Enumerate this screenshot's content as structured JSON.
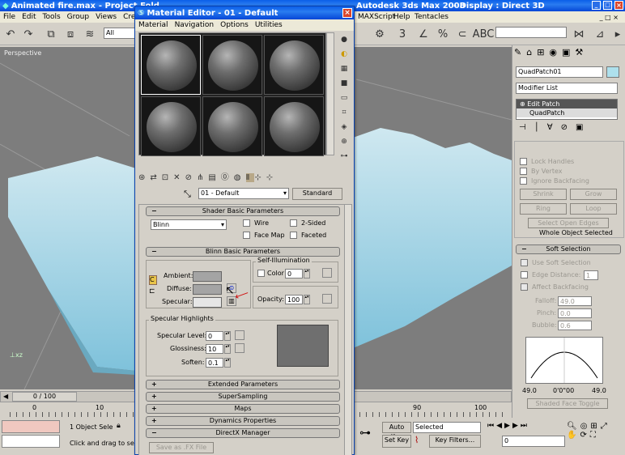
{
  "app": {
    "title": "Animated fire.max",
    "title_mid": "- Project Fold",
    "title_right": "Autodesk 3ds Max 2008",
    "title_display": "- Display : Direct 3D",
    "menus": [
      "File",
      "Edit",
      "Tools",
      "Group",
      "Views",
      "Create"
    ],
    "menus_right": [
      "MAXScript",
      "Help",
      "Tentacles"
    ],
    "selection_filter": "All",
    "viewport_label": "Perspective"
  },
  "material_editor": {
    "title": "Material Editor - 01 - Default",
    "menus": [
      "Material",
      "Navigation",
      "Options",
      "Utilities"
    ],
    "material_name": "01 - Default",
    "material_type": "Standard",
    "shader": {
      "header": "Shader Basic Parameters",
      "shader_type": "Blinn",
      "wire": "Wire",
      "two_sided": "2-Sided",
      "face_map": "Face Map",
      "faceted": "Faceted"
    },
    "blinn": {
      "header": "Blinn Basic Parameters",
      "self_illum": "Self-Illumination",
      "ambient": "Ambient:",
      "diffuse": "Diffuse:",
      "specular": "Specular:",
      "color_label": "Color",
      "color_value": "0",
      "opacity_label": "Opacity:",
      "opacity_value": "100"
    },
    "highlights": {
      "group": "Specular Highlights",
      "level_label": "Specular Level:",
      "level": "0",
      "gloss_label": "Glossiness:",
      "gloss": "10",
      "soften_label": "Soften:",
      "soften": "0.1"
    },
    "rollouts": [
      "Extended Parameters",
      "SuperSampling",
      "Maps",
      "Dynamics Properties",
      "DirectX Manager"
    ],
    "save_fx": "Save as .FX File"
  },
  "command_panel": {
    "object_name": "QuadPatch01",
    "modifier_list": "Modifier List",
    "stack": [
      "Edit Patch",
      "QuadPatch"
    ],
    "lock_handles": "Lock Handles",
    "by_vertex": "By Vertex",
    "ignore_backfacing": "Ignore Backfacing",
    "shrink": "Shrink",
    "grow": "Grow",
    "ring": "Ring",
    "loop": "Loop",
    "select_open_edges": "Select Open Edges",
    "whole_object": "Whole Object Selected",
    "soft_selection": "Soft Selection",
    "use_soft": "Use Soft Selection",
    "edge_distance": "Edge Distance:",
    "edge_distance_value": "1",
    "affect_backfacing": "Affect Backfacing",
    "falloff_label": "Falloff:",
    "falloff": "49.0",
    "pinch_label": "Pinch:",
    "pinch": "0.0",
    "bubble_label": "Bubble:",
    "bubble": "0.6",
    "curve_left": "49.0",
    "curve_mid": "0'0\"00",
    "curve_right": "49.0",
    "shaded_face_toggle": "Shaded Face Toggle"
  },
  "timeline": {
    "frame": "0 / 100",
    "ticks": [
      "0",
      "10",
      "90",
      "100"
    ]
  },
  "status": {
    "selection": "1 Object Sele",
    "prompt": "Click and drag to selec",
    "auto_key": "Auto Key",
    "selected": "Selected",
    "set_key": "Set Key",
    "key_filters": "Key Filters...",
    "current_frame": "0"
  }
}
